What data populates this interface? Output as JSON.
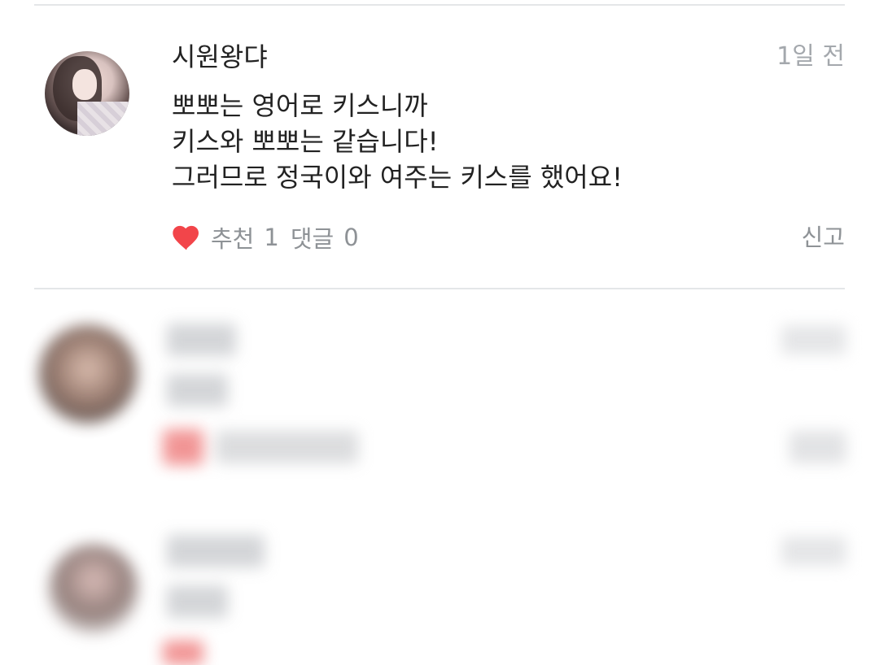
{
  "comment": {
    "username": "시원왕댜",
    "timestamp": "1일 전",
    "lines": [
      "뽀뽀는 영어로 키스니까",
      "키스와 뽀뽀는 같습니다!",
      "그러므로 정국이와 여주는 키스를 했어요!"
    ],
    "like_label": "추천",
    "like_count": "1",
    "reply_label": "댓글",
    "reply_count": "0",
    "report_label": "신고"
  },
  "colors": {
    "heart": "#f2454a",
    "meta_text": "#8e9296",
    "timestamp_text": "#a4a8ad",
    "divider": "#e4e6e8"
  },
  "icons": {
    "like": "heart-icon",
    "avatar": "user-avatar-photo"
  }
}
